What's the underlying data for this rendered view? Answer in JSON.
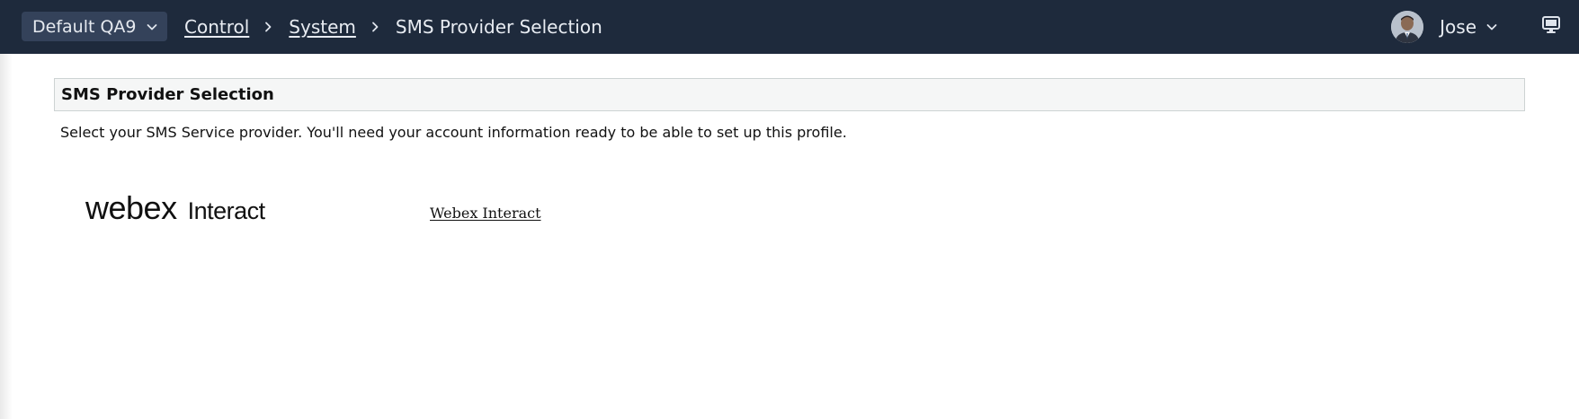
{
  "header": {
    "tenant_label": "Default QA9",
    "breadcrumb": {
      "items": [
        "Control",
        "System"
      ],
      "current": "SMS Provider Selection"
    },
    "user_name": "Jose",
    "icons": [
      "chevron-down-icon",
      "chevron-right-icon",
      "avatar",
      "monitor-icon"
    ]
  },
  "main": {
    "section_title": "SMS Provider Selection",
    "description": "Select your SMS Service provider. You'll need your account information ready to be able to set up this profile.",
    "providers": [
      {
        "logo_primary": "webex",
        "logo_secondary": "Interact",
        "link_label": "Webex Interact"
      }
    ]
  },
  "colors": {
    "topbar": "#1e2a3c",
    "tenant_pill": "#34425a",
    "section_header_bg": "#f5f6f6",
    "section_header_border": "#cdd3d3"
  }
}
